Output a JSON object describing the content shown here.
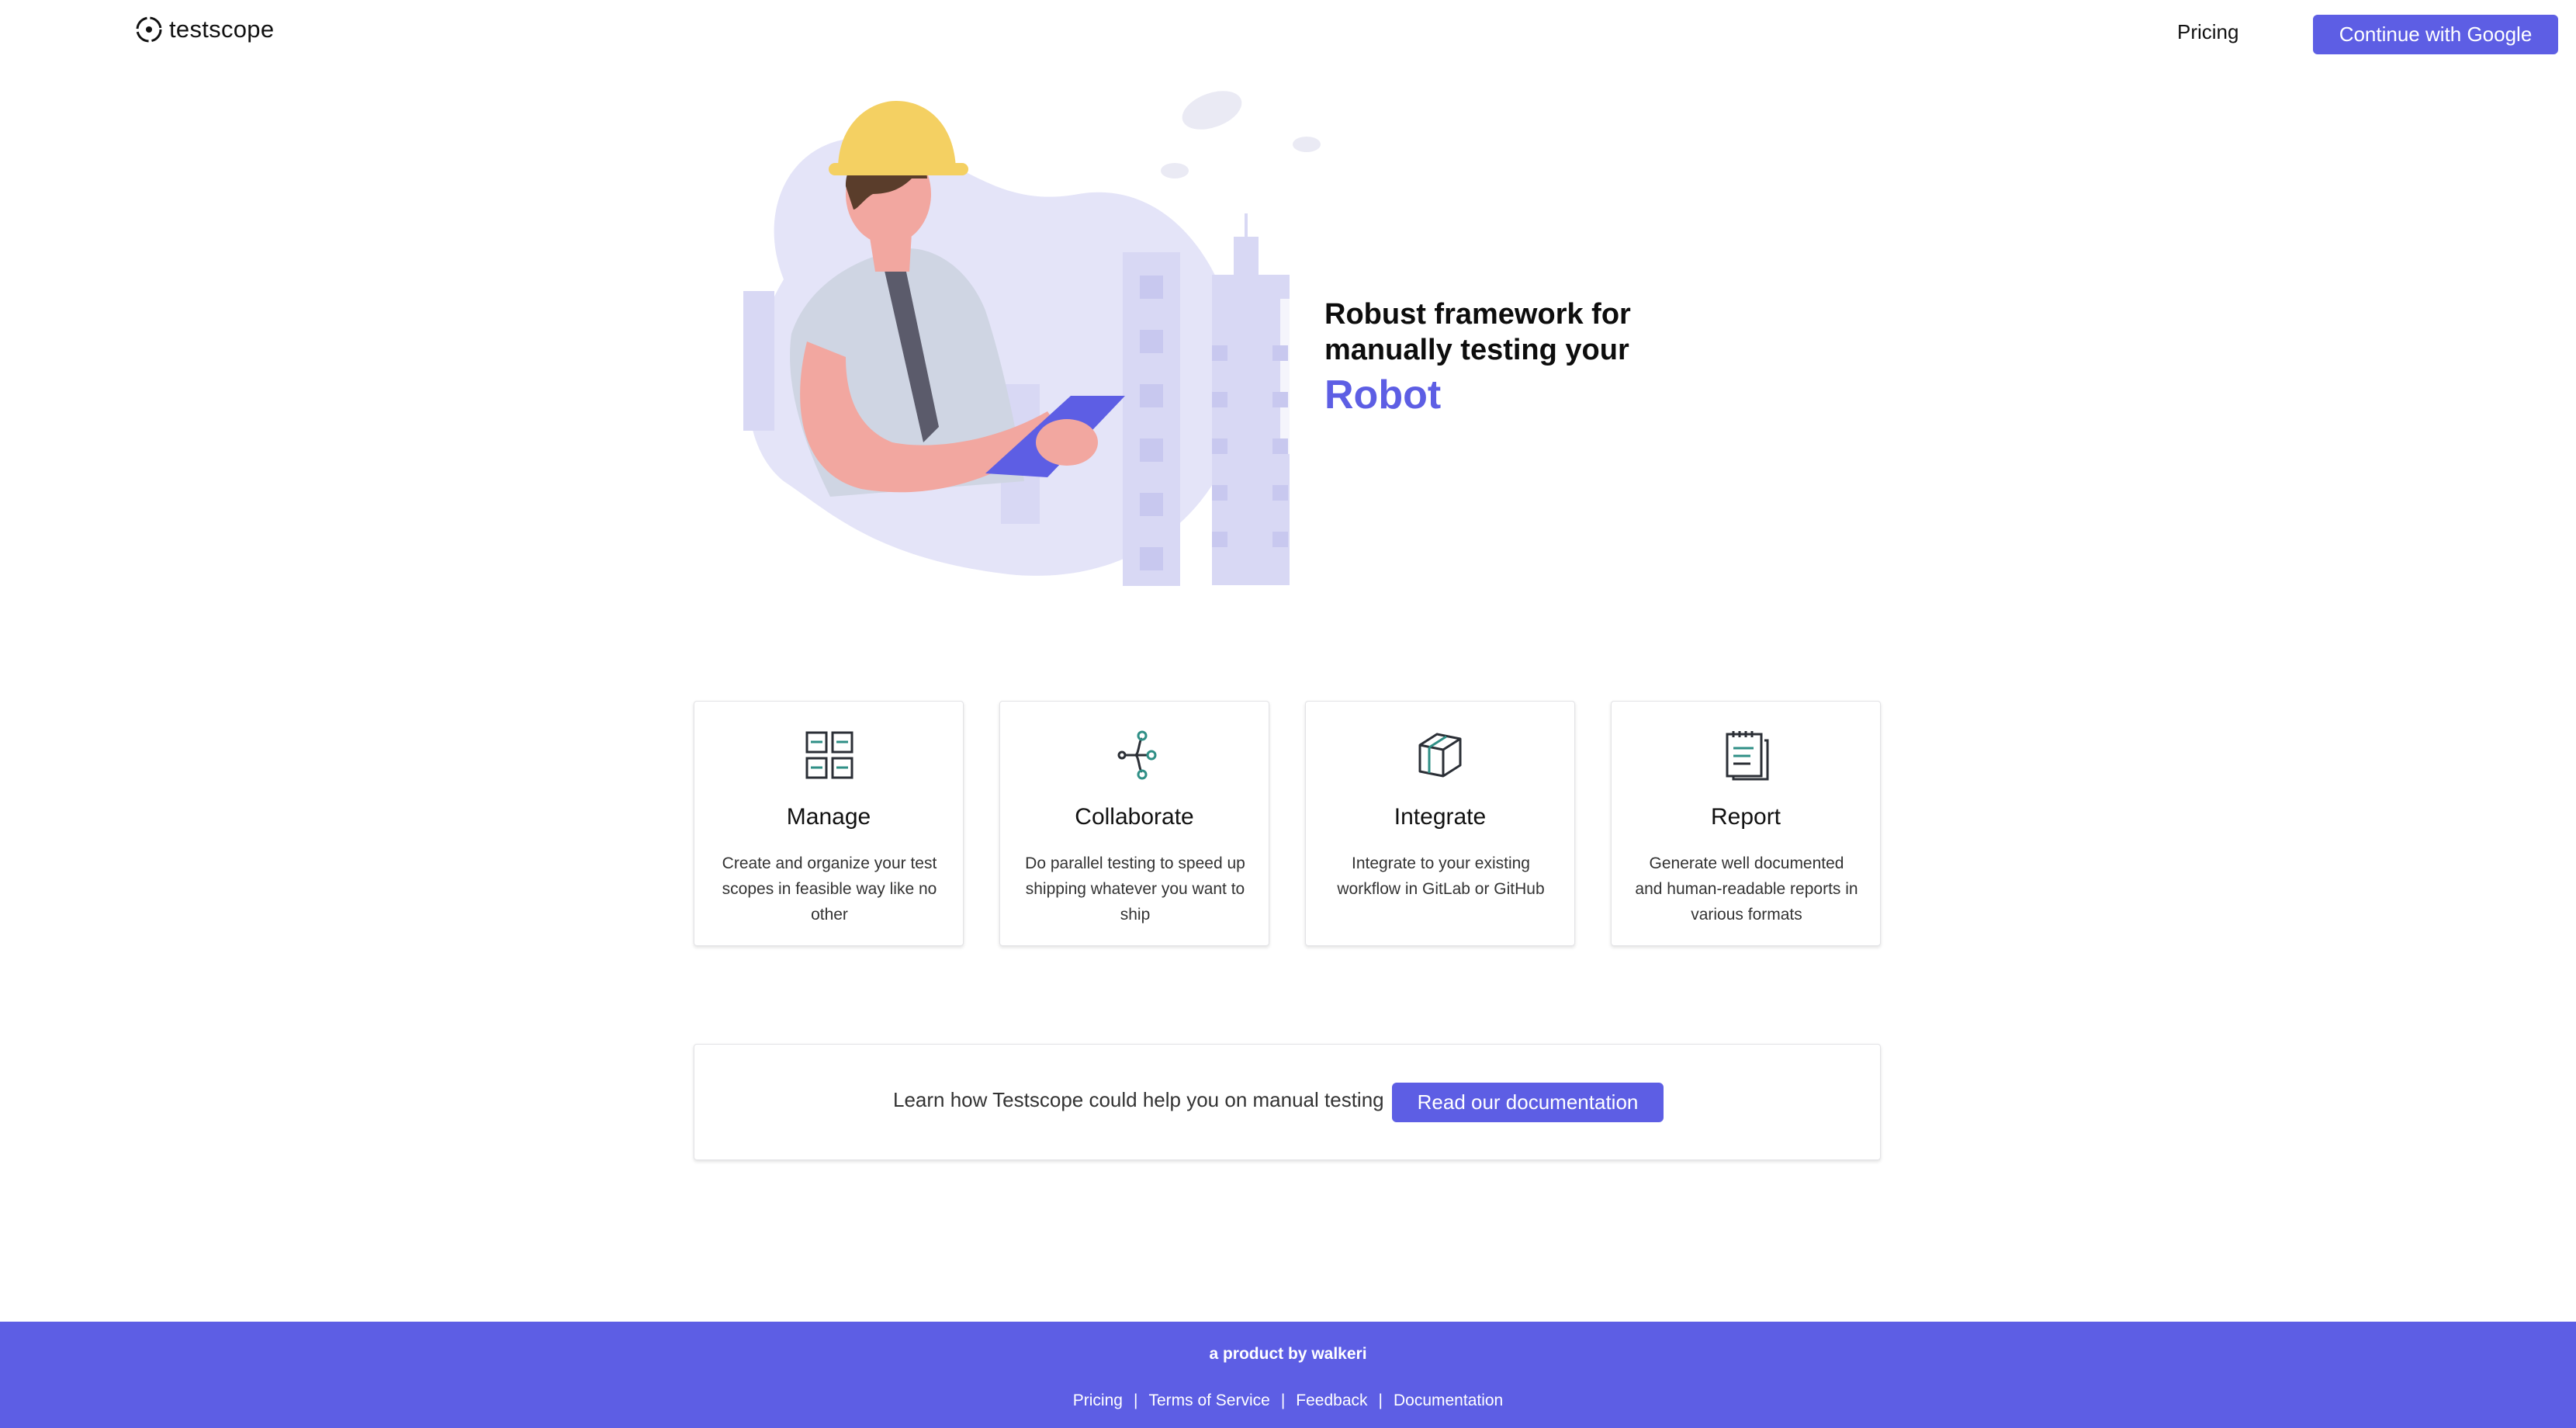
{
  "header": {
    "logo_text": "testscope",
    "nav_pricing": "Pricing",
    "google_button": "Continue with Google"
  },
  "hero": {
    "line1": "Robust framework for",
    "line2": "manually testing your",
    "highlight": "Robot"
  },
  "features": [
    {
      "icon": "grid-icon",
      "title": "Manage",
      "description": "Create and organize your test scopes in feasible way like no other"
    },
    {
      "icon": "branch-icon",
      "title": "Collaborate",
      "description": "Do parallel testing to speed up shipping whatever you want to ship"
    },
    {
      "icon": "package-icon",
      "title": "Integrate",
      "description": "Integrate to your existing workflow in GitLab or GitHub"
    },
    {
      "icon": "clipboard-icon",
      "title": "Report",
      "description": "Generate well documented and human-readable reports in various formats"
    }
  ],
  "docs": {
    "text": "Learn how Testscope could help you on manual testing",
    "button": "Read our documentation"
  },
  "footer": {
    "credit": "a product by walkeri",
    "links": [
      "Pricing",
      "Terms of Service",
      "Feedback",
      "Documentation"
    ],
    "separator": "|"
  },
  "colors": {
    "accent": "#5d5ee4",
    "illustration_bg": "#e4e4f8",
    "helmet": "#f4d062",
    "skin": "#f2a7a0",
    "shirt": "#cfd5e3",
    "tie": "#5b5b6b",
    "icon_teal": "#2f8f86",
    "icon_dark": "#2b2f36"
  }
}
